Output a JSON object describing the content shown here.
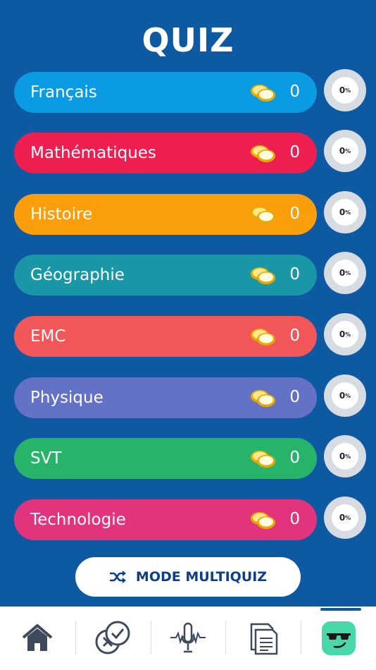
{
  "title": "QUIZ",
  "subjects": [
    {
      "name": "Français",
      "coins": "0",
      "progress": "0",
      "unit": "%",
      "color": "#0a9be3"
    },
    {
      "name": "Mathématiques",
      "coins": "0",
      "progress": "0",
      "unit": "%",
      "color": "#ec1f50"
    },
    {
      "name": "Histoire",
      "coins": "0",
      "progress": "0",
      "unit": "%",
      "color": "#fa9e0b"
    },
    {
      "name": "Géographie",
      "coins": "0",
      "progress": "0",
      "unit": "%",
      "color": "#1a97a6"
    },
    {
      "name": "EMC",
      "coins": "0",
      "progress": "0",
      "unit": "%",
      "color": "#f15658"
    },
    {
      "name": "Physique",
      "coins": "0",
      "progress": "0",
      "unit": "%",
      "color": "#6472c5"
    },
    {
      "name": "SVT",
      "coins": "0",
      "progress": "0",
      "unit": "%",
      "color": "#27b46a"
    },
    {
      "name": "Technologie",
      "coins": "0",
      "progress": "0",
      "unit": "%",
      "color": "#e2337d"
    }
  ],
  "multiquiz": {
    "label": "MODE MULTIQUIZ",
    "icon": "shuffle-icon"
  },
  "tabbar": {
    "items": [
      {
        "icon": "home-icon"
      },
      {
        "icon": "quiz-check-icon"
      },
      {
        "icon": "microphone-icon"
      },
      {
        "icon": "documents-icon"
      },
      {
        "icon": "avatar-sunglasses-icon",
        "active": true
      }
    ]
  }
}
